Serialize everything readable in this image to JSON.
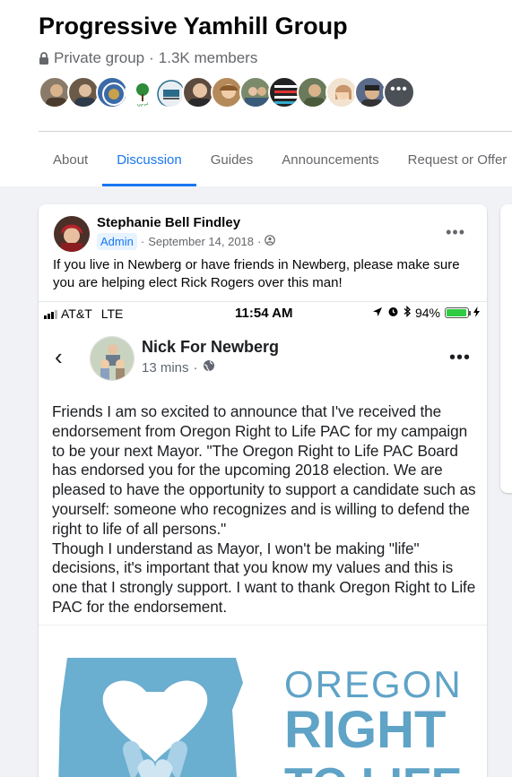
{
  "group": {
    "name": "Progressive Yamhill Group",
    "privacy": "Private group",
    "separator": "·",
    "members": "1.3K members",
    "member_avatars": [
      {
        "name": "member-1",
        "color": "#8a7a6a"
      },
      {
        "name": "member-2",
        "color": "#6b5a48"
      },
      {
        "name": "member-3",
        "color": "#3b6aa8"
      },
      {
        "name": "member-4",
        "color": "#ffffff",
        "label": "ycd"
      },
      {
        "name": "member-5",
        "color": "#2a6b8a"
      },
      {
        "name": "member-6",
        "color": "#5c4a3e"
      },
      {
        "name": "member-7",
        "color": "#b58a5a"
      },
      {
        "name": "member-8",
        "color": "#7a8a6a"
      },
      {
        "name": "member-9",
        "color": "#222222"
      },
      {
        "name": "member-10",
        "color": "#6a7a5a"
      },
      {
        "name": "member-11",
        "color": "#c9956a"
      },
      {
        "name": "member-12",
        "color": "#5a6a8a"
      }
    ],
    "more_glyph": "•••"
  },
  "tabs": [
    {
      "label": "About",
      "active": false
    },
    {
      "label": "Discussion",
      "active": true
    },
    {
      "label": "Guides",
      "active": false
    },
    {
      "label": "Announcements",
      "active": false
    },
    {
      "label": "Request or Offer",
      "active": false
    }
  ],
  "post": {
    "author": "Stephanie Bell Findley",
    "badge": "Admin",
    "date": "September 14, 2018",
    "date_separator": "·",
    "more_glyph": "•••",
    "text": "If you live in Newberg or have friends in Newberg, please make sure you are helping elect Rick Rogers over this man!",
    "screenshot": {
      "carrier": "AT&T",
      "network": "LTE",
      "time": "11:54 AM",
      "battery": "94%",
      "battery_level": 0.94,
      "back_glyph": "‹",
      "page_name": "Nick For Newberg",
      "posted_ago": "13 mins",
      "posted_separator": "·",
      "more_glyph": "•••",
      "body": "Friends I am so excited to announce that I've received the endorsement from Oregon Right to Life PAC for my campaign to be your next Mayor. \"The Oregon Right to Life PAC Board has endorsed you for the upcoming 2018 election.  We are pleased to have the opportunity to support a candidate such as yourself: someone who recognizes and is willing to defend the right to life of all persons.\"\nThough I understand as Mayor, I won't be making \"life\" decisions, it's important that you know my values and this is one that I strongly support.  I want to thank Oregon Right to Life PAC for the endorsement.",
      "logo_line1": "OREGON",
      "logo_line2": "RIGHT",
      "logo_line3": "TO LIFE"
    }
  },
  "colors": {
    "accent": "#1877f2",
    "logo_blue": "#5fa3c7"
  }
}
